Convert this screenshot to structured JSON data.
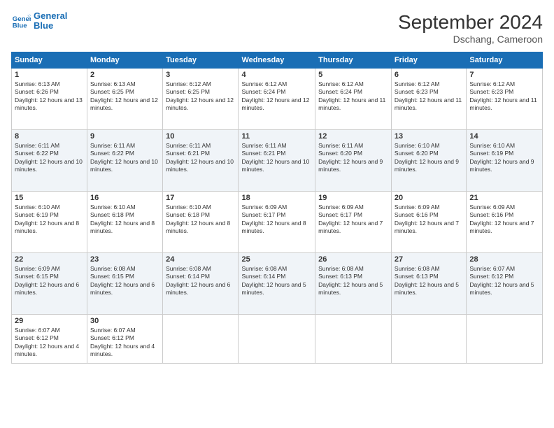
{
  "header": {
    "logo_line1": "General",
    "logo_line2": "Blue",
    "month_title": "September 2024",
    "location": "Dschang, Cameroon"
  },
  "days_of_week": [
    "Sunday",
    "Monday",
    "Tuesday",
    "Wednesday",
    "Thursday",
    "Friday",
    "Saturday"
  ],
  "weeks": [
    [
      {
        "day": "1",
        "sunrise": "6:13 AM",
        "sunset": "6:26 PM",
        "daylight": "12 hours and 13 minutes."
      },
      {
        "day": "2",
        "sunrise": "6:13 AM",
        "sunset": "6:25 PM",
        "daylight": "12 hours and 12 minutes."
      },
      {
        "day": "3",
        "sunrise": "6:12 AM",
        "sunset": "6:25 PM",
        "daylight": "12 hours and 12 minutes."
      },
      {
        "day": "4",
        "sunrise": "6:12 AM",
        "sunset": "6:24 PM",
        "daylight": "12 hours and 12 minutes."
      },
      {
        "day": "5",
        "sunrise": "6:12 AM",
        "sunset": "6:24 PM",
        "daylight": "12 hours and 11 minutes."
      },
      {
        "day": "6",
        "sunrise": "6:12 AM",
        "sunset": "6:23 PM",
        "daylight": "12 hours and 11 minutes."
      },
      {
        "day": "7",
        "sunrise": "6:12 AM",
        "sunset": "6:23 PM",
        "daylight": "12 hours and 11 minutes."
      }
    ],
    [
      {
        "day": "8",
        "sunrise": "6:11 AM",
        "sunset": "6:22 PM",
        "daylight": "12 hours and 10 minutes."
      },
      {
        "day": "9",
        "sunrise": "6:11 AM",
        "sunset": "6:22 PM",
        "daylight": "12 hours and 10 minutes."
      },
      {
        "day": "10",
        "sunrise": "6:11 AM",
        "sunset": "6:21 PM",
        "daylight": "12 hours and 10 minutes."
      },
      {
        "day": "11",
        "sunrise": "6:11 AM",
        "sunset": "6:21 PM",
        "daylight": "12 hours and 10 minutes."
      },
      {
        "day": "12",
        "sunrise": "6:11 AM",
        "sunset": "6:20 PM",
        "daylight": "12 hours and 9 minutes."
      },
      {
        "day": "13",
        "sunrise": "6:10 AM",
        "sunset": "6:20 PM",
        "daylight": "12 hours and 9 minutes."
      },
      {
        "day": "14",
        "sunrise": "6:10 AM",
        "sunset": "6:19 PM",
        "daylight": "12 hours and 9 minutes."
      }
    ],
    [
      {
        "day": "15",
        "sunrise": "6:10 AM",
        "sunset": "6:19 PM",
        "daylight": "12 hours and 8 minutes."
      },
      {
        "day": "16",
        "sunrise": "6:10 AM",
        "sunset": "6:18 PM",
        "daylight": "12 hours and 8 minutes."
      },
      {
        "day": "17",
        "sunrise": "6:10 AM",
        "sunset": "6:18 PM",
        "daylight": "12 hours and 8 minutes."
      },
      {
        "day": "18",
        "sunrise": "6:09 AM",
        "sunset": "6:17 PM",
        "daylight": "12 hours and 8 minutes."
      },
      {
        "day": "19",
        "sunrise": "6:09 AM",
        "sunset": "6:17 PM",
        "daylight": "12 hours and 7 minutes."
      },
      {
        "day": "20",
        "sunrise": "6:09 AM",
        "sunset": "6:16 PM",
        "daylight": "12 hours and 7 minutes."
      },
      {
        "day": "21",
        "sunrise": "6:09 AM",
        "sunset": "6:16 PM",
        "daylight": "12 hours and 7 minutes."
      }
    ],
    [
      {
        "day": "22",
        "sunrise": "6:09 AM",
        "sunset": "6:15 PM",
        "daylight": "12 hours and 6 minutes."
      },
      {
        "day": "23",
        "sunrise": "6:08 AM",
        "sunset": "6:15 PM",
        "daylight": "12 hours and 6 minutes."
      },
      {
        "day": "24",
        "sunrise": "6:08 AM",
        "sunset": "6:14 PM",
        "daylight": "12 hours and 6 minutes."
      },
      {
        "day": "25",
        "sunrise": "6:08 AM",
        "sunset": "6:14 PM",
        "daylight": "12 hours and 5 minutes."
      },
      {
        "day": "26",
        "sunrise": "6:08 AM",
        "sunset": "6:13 PM",
        "daylight": "12 hours and 5 minutes."
      },
      {
        "day": "27",
        "sunrise": "6:08 AM",
        "sunset": "6:13 PM",
        "daylight": "12 hours and 5 minutes."
      },
      {
        "day": "28",
        "sunrise": "6:07 AM",
        "sunset": "6:12 PM",
        "daylight": "12 hours and 5 minutes."
      }
    ],
    [
      {
        "day": "29",
        "sunrise": "6:07 AM",
        "sunset": "6:12 PM",
        "daylight": "12 hours and 4 minutes."
      },
      {
        "day": "30",
        "sunrise": "6:07 AM",
        "sunset": "6:12 PM",
        "daylight": "12 hours and 4 minutes."
      },
      null,
      null,
      null,
      null,
      null
    ]
  ]
}
